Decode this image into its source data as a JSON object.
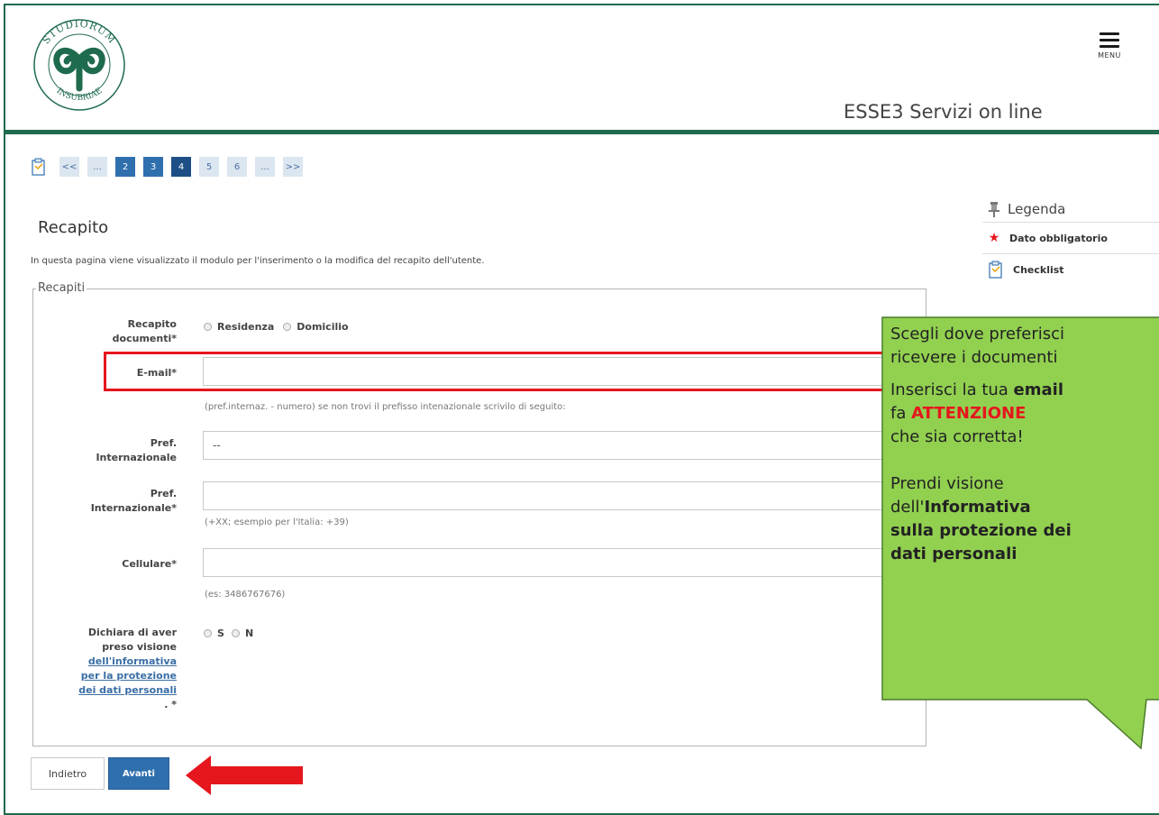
{
  "header": {
    "logo_text_top": "STUDIORUM",
    "logo_text_left": "UNIVERSITAS",
    "logo_text_right": "INSUBRIAE",
    "menu_label": "MENU",
    "service_title": "ESSE3 Servizi on line"
  },
  "pager": {
    "items": [
      {
        "label": "<<",
        "style": "light"
      },
      {
        "label": "...",
        "style": "light"
      },
      {
        "label": "2",
        "style": "dark"
      },
      {
        "label": "3",
        "style": "dark"
      },
      {
        "label": "4",
        "style": "current"
      },
      {
        "label": "5",
        "style": "light"
      },
      {
        "label": "6",
        "style": "light"
      },
      {
        "label": "...",
        "style": "light"
      },
      {
        "label": ">>",
        "style": "light"
      }
    ]
  },
  "page": {
    "title": "Recapito",
    "description": "In questa pagina viene visualizzato il modulo per l'inserimento o la modifica del recapito dell'utente."
  },
  "form": {
    "legend": "Recapiti",
    "recapito_label_1": "Recapito",
    "recapito_label_2": "documenti*",
    "residenza": "Residenza",
    "domicilio": "Domicilio",
    "email_label": "E-mail*",
    "email_value": "",
    "email_hint": "(pref.internaz. - numero) se non trovi il prefisso intenazionale scrivilo di seguito:",
    "pref1_label_1": "Pref.",
    "pref1_label_2": "Internazionale",
    "pref1_value": "--",
    "pref2_label_1": "Pref.",
    "pref2_label_2": "Internazionale*",
    "pref2_value": "",
    "pref2_hint": "(+XX; esempio per l'Italia: +39)",
    "cell_label": "Cellulare*",
    "cell_value": "",
    "cell_hint": "(es: 3486767676)",
    "dich_label_1": "Dichiara di aver",
    "dich_label_2": "preso visione",
    "dich_link_1": "dell'informativa",
    "dich_link_2": "per la protezione",
    "dich_link_3": "dei dati personali",
    "dich_label_3": ". *",
    "opt_s": "S",
    "opt_n": "N"
  },
  "buttons": {
    "back": "Indietro",
    "next": "Avanti"
  },
  "legend_panel": {
    "title": "Legenda",
    "required": "Dato obbligatorio",
    "checklist": "Checklist"
  },
  "callout": {
    "line1": "Scegli dove preferisci",
    "line2": "ricevere i documenti",
    "line3a": "Inserisci la tua ",
    "line3b": "email",
    "line4a": "fa ",
    "line4b": "ATTENZIONE",
    "line5": "che sia corretta!",
    "line6": "Prendi visione",
    "line7a": "dell'",
    "line7b": "Informativa",
    "line8": "sulla protezione dei",
    "line9": "dati personali"
  },
  "colors": {
    "brand_green": "#1f6b4d",
    "primary_blue": "#2f6fae",
    "alert_red": "#e5161d",
    "callout_green": "#92d050"
  }
}
